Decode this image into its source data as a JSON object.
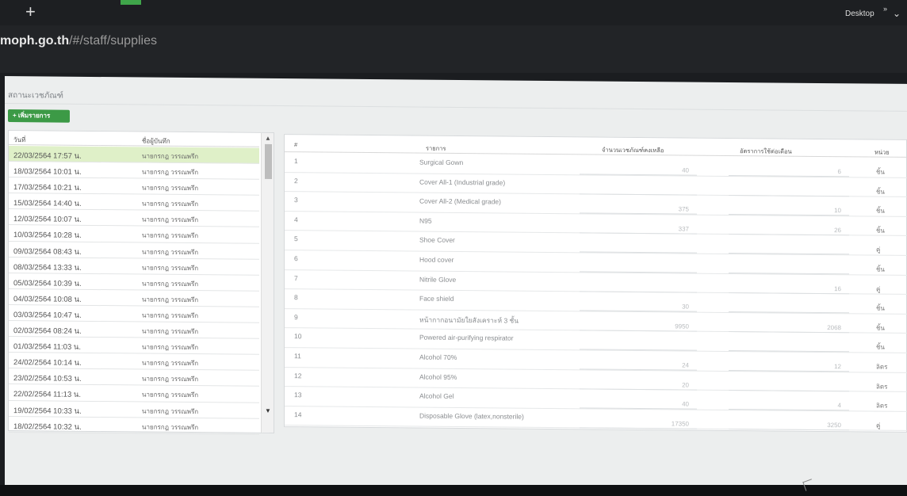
{
  "browser": {
    "new_tab_label": "+",
    "url_host": "moph.go.th",
    "url_path": "/#/staff/supplies",
    "desktop_label": "Desktop",
    "more_label": "»",
    "chevron_label": "⌄"
  },
  "page": {
    "title": "สถานะเวชภัณฑ์",
    "add_button": "+ เพิ่มรายการ"
  },
  "history": {
    "headers": {
      "date": "วันที่",
      "user": "ชื่อผู้บันทึก"
    },
    "rows": [
      {
        "date": "22/03/2564 17:57 น.",
        "user": "นายกรกฎ วรรณพรึก"
      },
      {
        "date": "18/03/2564 10:01 น.",
        "user": "นายกรกฎ วรรณพรึก"
      },
      {
        "date": "17/03/2564 10:21 น.",
        "user": "นายกรกฎ วรรณพรึก"
      },
      {
        "date": "15/03/2564 14:40 น.",
        "user": "นายกรกฎ วรรณพรึก"
      },
      {
        "date": "12/03/2564 10:07 น.",
        "user": "นายกรกฎ วรรณพรึก"
      },
      {
        "date": "10/03/2564 10:28 น.",
        "user": "นายกรกฎ วรรณพรึก"
      },
      {
        "date": "09/03/2564 08:43 น.",
        "user": "นายกรกฎ วรรณพรึก"
      },
      {
        "date": "08/03/2564 13:33 น.",
        "user": "นายกรกฎ วรรณพรึก"
      },
      {
        "date": "05/03/2564 10:39 น.",
        "user": "นายกรกฎ วรรณพรึก"
      },
      {
        "date": "04/03/2564 10:08 น.",
        "user": "นายกรกฎ วรรณพรึก"
      },
      {
        "date": "03/03/2564 10:47 น.",
        "user": "นายกรกฎ วรรณพรึก"
      },
      {
        "date": "02/03/2564 08:24 น.",
        "user": "นายกรกฎ วรรณพรึก"
      },
      {
        "date": "01/03/2564 11:03 น.",
        "user": "นายกรกฎ วรรณพรึก"
      },
      {
        "date": "24/02/2564 10:14 น.",
        "user": "นายกรกฎ วรรณพรึก"
      },
      {
        "date": "23/02/2564 10:53 น.",
        "user": "นายกรกฎ วรรณพรึก"
      },
      {
        "date": "22/02/2564 11:13 น.",
        "user": "นายกรกฎ วรรณพรึก"
      },
      {
        "date": "19/02/2564 10:33 น.",
        "user": "นายกรกฎ วรรณพรึก"
      },
      {
        "date": "18/02/2564 10:32 น.",
        "user": "นายกรกฎ วรรณพรึก"
      }
    ],
    "scroll_up": "▲",
    "scroll_down": "▼"
  },
  "supplies": {
    "headers": {
      "num": "#",
      "item": "รายการ",
      "remaining": "จำนวนเวชภัณฑ์คงเหลือ",
      "usage": "อัตราการใช้ต่อเดือน",
      "unit": "หน่วย"
    },
    "rows": [
      {
        "n": "1",
        "item": "Surgical Gown",
        "remaining": "40",
        "usage": "6",
        "unit": "ชิ้น"
      },
      {
        "n": "2",
        "item": "Cover All-1 (Industrial grade)",
        "remaining": "",
        "usage": "",
        "unit": "ชิ้น"
      },
      {
        "n": "3",
        "item": "Cover All-2 (Medical grade)",
        "remaining": "375",
        "usage": "10",
        "unit": "ชิ้น"
      },
      {
        "n": "4",
        "item": "N95",
        "remaining": "337",
        "usage": "26",
        "unit": "ชิ้น"
      },
      {
        "n": "5",
        "item": "Shoe Cover",
        "remaining": "",
        "usage": "",
        "unit": "คู่"
      },
      {
        "n": "6",
        "item": "Hood cover",
        "remaining": "",
        "usage": "",
        "unit": "ชิ้น"
      },
      {
        "n": "7",
        "item": "Nitrile Glove",
        "remaining": "",
        "usage": "16",
        "unit": "คู่"
      },
      {
        "n": "8",
        "item": "Face shield",
        "remaining": "30",
        "usage": "",
        "unit": "ชิ้น"
      },
      {
        "n": "9",
        "item": "หน้ากากอนามัยใยสังเคราะห์ 3 ชั้น",
        "remaining": "9950",
        "usage": "2068",
        "unit": "ชิ้น"
      },
      {
        "n": "10",
        "item": "Powered air-purifying respirator",
        "remaining": "",
        "usage": "",
        "unit": "ชิ้น"
      },
      {
        "n": "11",
        "item": "Alcohol 70%",
        "remaining": "24",
        "usage": "12",
        "unit": "ลิตร"
      },
      {
        "n": "12",
        "item": "Alcohol 95%",
        "remaining": "20",
        "usage": "",
        "unit": "ลิตร"
      },
      {
        "n": "13",
        "item": "Alcohol Gel",
        "remaining": "40",
        "usage": "4",
        "unit": "ลิตร"
      },
      {
        "n": "14",
        "item": "Disposable Glove (latex,nonsterile)",
        "remaining": "17350",
        "usage": "3250",
        "unit": "คู่"
      }
    ]
  }
}
